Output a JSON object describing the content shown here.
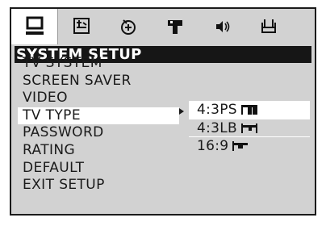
{
  "tabs": [
    {
      "icon": "monitor-icon",
      "selected": true
    },
    {
      "icon": "audio-language-icon"
    },
    {
      "icon": "subtitle-icon"
    },
    {
      "icon": "speaker-icon"
    },
    {
      "icon": "volume-icon"
    },
    {
      "icon": "preferences-icon"
    }
  ],
  "header": {
    "title": "SYSTEM SETUP"
  },
  "menu": {
    "items": [
      {
        "label": "TV SYSTEM"
      },
      {
        "label": "SCREEN SAVER"
      },
      {
        "label": "VIDEO"
      },
      {
        "label": "TV TYPE",
        "selected": true
      },
      {
        "label": "PASSWORD"
      },
      {
        "label": "RATING"
      },
      {
        "label": "DEFAULT"
      },
      {
        "label": "EXIT SETUP"
      }
    ]
  },
  "submenu": {
    "items": [
      {
        "label": "4:3PS",
        "icon": "pan-scan-icon",
        "selected": true
      },
      {
        "label": "4:3LB",
        "icon": "letterbox-icon"
      },
      {
        "label": "16:9",
        "icon": "widescreen-icon"
      }
    ]
  },
  "colors": {
    "frame": "#d2d2d2",
    "header": "#161616",
    "highlight": "#ffffff"
  }
}
